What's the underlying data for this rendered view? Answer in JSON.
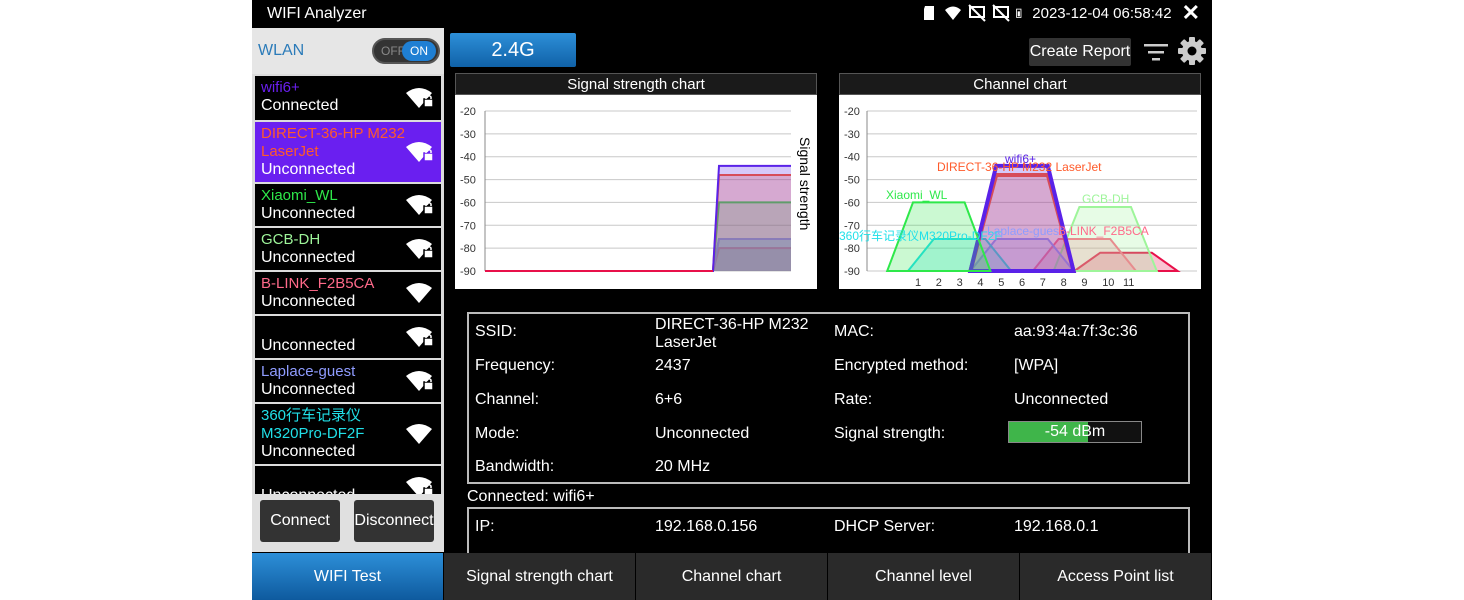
{
  "app": {
    "title": "WIFI Analyzer",
    "datetime": "2023-12-04 06:58:42"
  },
  "wlan": {
    "label": "WLAN",
    "toggle_off": "OFF",
    "toggle_on": "ON"
  },
  "networks": [
    {
      "name": "wifi6+",
      "status": "Connected",
      "color": "#6a1ff0",
      "locked": true
    },
    {
      "name": "DIRECT-36-HP M232\nLaserJet",
      "status": "Unconnected",
      "color": "#ff5a2a",
      "locked": true,
      "selected": true
    },
    {
      "name": "Xiaomi_WL",
      "status": "Unconnected",
      "color": "#2ee84a",
      "locked": true
    },
    {
      "name": "GCB-DH",
      "status": "Unconnected",
      "color": "#9ef59a",
      "locked": true
    },
    {
      "name": "B-LINK_F2B5CA",
      "status": "Unconnected",
      "color": "#ff6a8a",
      "locked": false
    },
    {
      "name": "",
      "status": "Unconnected",
      "color": "#ffffff",
      "locked": true
    },
    {
      "name": "Laplace-guest",
      "status": "Unconnected",
      "color": "#8f9cff",
      "locked": true
    },
    {
      "name": "360行车记录仪\nM320Pro-DF2F",
      "status": "Unconnected",
      "color": "#21e0e8",
      "locked": false
    },
    {
      "name": "",
      "status": "Unconnected",
      "color": "#ffffff",
      "locked": true
    }
  ],
  "buttons": {
    "connect": "Connect",
    "disconnect": "Disconnect",
    "band": "2.4G",
    "create_report": "Create Report"
  },
  "signal_chart": {
    "title": "Signal strength chart",
    "ylabel": "Signal strength",
    "yticks": [
      "-20",
      "-30",
      "-40",
      "-50",
      "-60",
      "-70",
      "-80",
      "-90"
    ]
  },
  "channel_chart": {
    "title": "Channel chart",
    "yticks": [
      "-20",
      "-30",
      "-40",
      "-50",
      "-60",
      "-70",
      "-80",
      "-90"
    ],
    "xticks": [
      "1",
      "2",
      "3",
      "4",
      "5",
      "6",
      "7",
      "8",
      "9",
      "10",
      "11"
    ],
    "labels": {
      "wifi6": "wifi6+",
      "direct": "DIRECT-36-HP M232 LaserJet",
      "xiaomi": "Xiaomi_WL",
      "gcb": "GCB-DH",
      "c360": "360行车记录仪M320Pro-DF2F",
      "laplace": "Laplace-guest",
      "blink": "B-LINK_F2B5CA"
    }
  },
  "chart_data": [
    {
      "type": "line",
      "title": "Signal strength chart",
      "ylabel": "Signal strength",
      "ylim": [
        -90,
        -20
      ],
      "series": [
        {
          "name": "wifi6+",
          "color": "#5a22e8",
          "final": -44
        },
        {
          "name": "DIRECT-36-HP M232 LaserJet",
          "color": "#ff5a2a",
          "final": -48
        },
        {
          "name": "Xiaomi_WL",
          "color": "#2ee84a",
          "final": -60
        },
        {
          "name": "Laplace-guest",
          "color": "#8f9cff",
          "final": -76
        },
        {
          "name": "360行车记录仪M320Pro-DF2F",
          "color": "#21e0e8",
          "final": -76
        },
        {
          "name": "B-LINK_F2B5CA",
          "color": "#ff6a8a",
          "final": -80
        },
        {
          "name": "GCB-DH",
          "color": "#9ef59a",
          "final": -80
        }
      ]
    },
    {
      "type": "area",
      "title": "Channel chart",
      "x": [
        1,
        2,
        3,
        4,
        5,
        6,
        7,
        8,
        9,
        10,
        11
      ],
      "ylim": [
        -90,
        -20
      ],
      "series": [
        {
          "name": "Xiaomi_WL",
          "channel": 2,
          "level": -60,
          "color": "#2ee84a"
        },
        {
          "name": "wifi6+",
          "channel": 6,
          "level": -44,
          "color": "#5a22e8"
        },
        {
          "name": "DIRECT-36-HP M232 LaserJet",
          "channel": 6,
          "level": -48,
          "color": "#ff5a2a"
        },
        {
          "name": "360行车记录仪M320Pro-DF2F",
          "channel": 3,
          "level": -76,
          "color": "#21e0e8"
        },
        {
          "name": "Laplace-guest",
          "channel": 6,
          "level": -76,
          "color": "#8f9cff"
        },
        {
          "name": "GCB-DH",
          "channel": 10,
          "level": -62,
          "color": "#9ef59a"
        },
        {
          "name": "B-LINK_F2B5CA",
          "channel": 9,
          "level": -76,
          "color": "#ff6a8a"
        },
        {
          "name": "",
          "channel": 11,
          "level": -82,
          "color": "#e8104a"
        }
      ]
    }
  ],
  "details": {
    "ssid_label": "SSID:",
    "ssid": "DIRECT-36-HP M232\nLaserJet",
    "mac_label": "MAC:",
    "mac": "aa:93:4a:7f:3c:36",
    "freq_label": "Frequency:",
    "freq": "2437",
    "enc_label": "Encrypted method:",
    "enc": "[WPA]",
    "channel_label": "Channel:",
    "channel": "6+6",
    "rate_label": "Rate:",
    "rate": "Unconnected",
    "mode_label": "Mode:",
    "mode": "Unconnected",
    "strength_label": "Signal strength:",
    "strength": "-54 dBm",
    "strength_fraction": 0.6,
    "bw_label": "Bandwidth:",
    "bw": "20 MHz"
  },
  "connection": {
    "title": "Connected: wifi6+",
    "ip_label": "IP:",
    "ip": "192.168.0.156",
    "dhcp_label": "DHCP Server:",
    "dhcp": "192.168.0.1"
  },
  "tabs": [
    "WIFI Test",
    "Signal strength chart",
    "Channel chart",
    "Channel level",
    "Access Point list"
  ]
}
